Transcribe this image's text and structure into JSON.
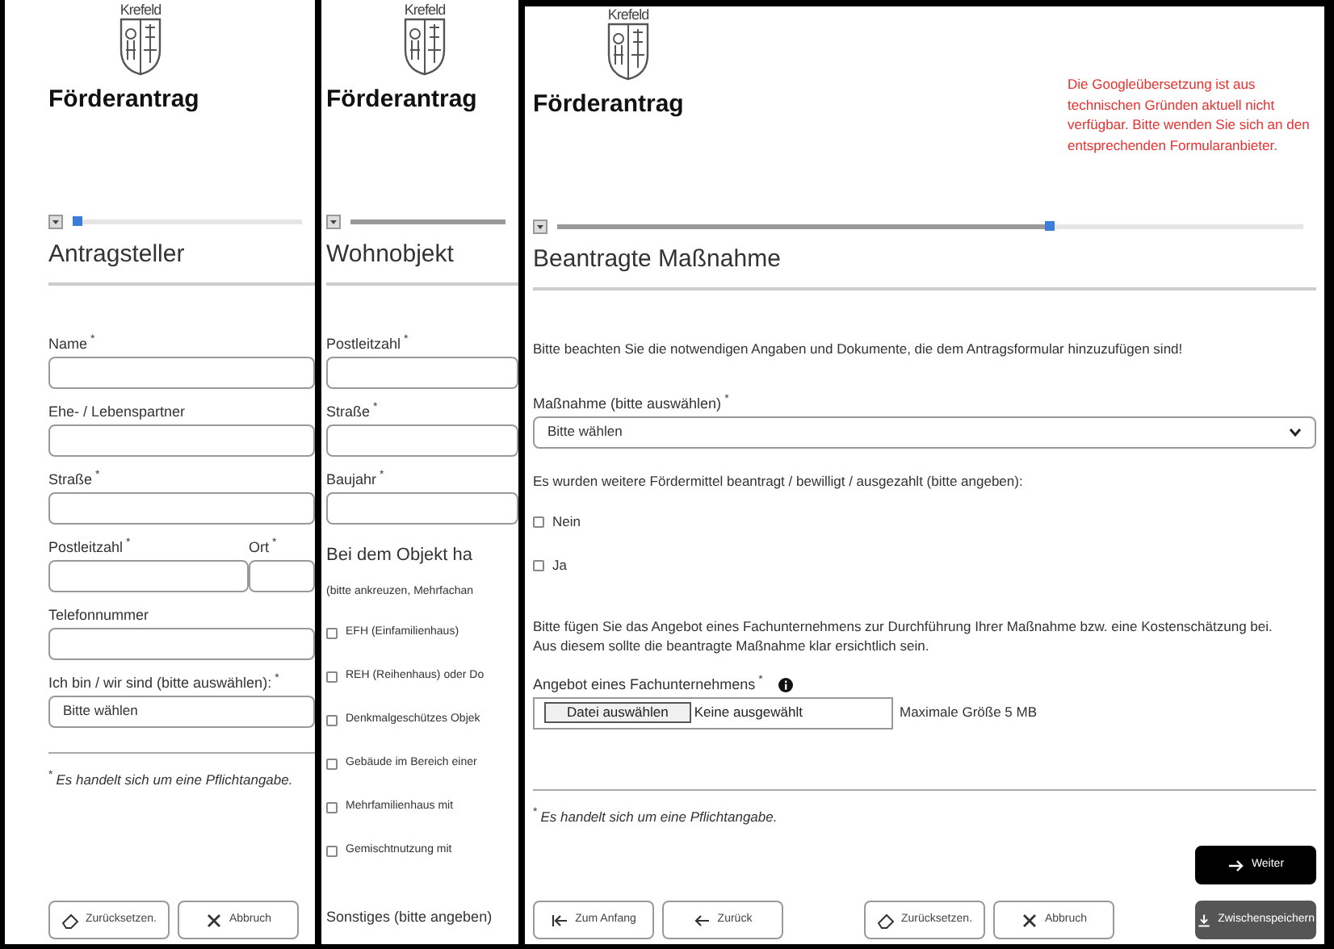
{
  "panels": [
    {
      "logo_text": "Krefeld",
      "title": "Förderantrag",
      "progress": {
        "level": 0.02
      },
      "section_title": "Antragsteller",
      "items": [
        {
          "kind": "field",
          "label": "Name",
          "mark": "*"
        },
        {
          "kind": "field",
          "label": "Ehe- / Lebenspartner"
        },
        {
          "kind": "field",
          "label": "Straße",
          "mark": "*"
        },
        {
          "kind": "pair",
          "fields": [
            {
              "label": "Postleitzahl",
              "mark": "*"
            },
            {
              "label": "Ort",
              "mark": "*"
            }
          ]
        },
        {
          "kind": "field",
          "label": "Telefonnummer"
        },
        {
          "kind": "select",
          "label": "Ich bin / wir sind (bitte auswählen):",
          "mark": "*",
          "value": "Bitte wählen"
        },
        {
          "kind": "divider"
        },
        {
          "kind": "note",
          "mark": "*",
          "text": "Es handelt sich um eine Pflichtangabe."
        }
      ],
      "buttons": [
        [
          {
            "kind": "reset",
            "label": "Zurücksetzen."
          },
          {
            "kind": "cancel",
            "label": "Abbruch"
          }
        ]
      ]
    },
    {
      "logo_text": "Krefeld",
      "title": "Förderantrag",
      "progress": {
        "level": 1
      },
      "section_title": "Wohnobjekt",
      "items": [
        {
          "kind": "field",
          "label": "Postleitzahl",
          "mark": "*"
        },
        {
          "kind": "field",
          "label": "Straße",
          "mark": "*"
        },
        {
          "kind": "field",
          "label": "Baujahr",
          "mark": "*"
        },
        {
          "kind": "heading",
          "text": "Bei dem Objekt ha"
        },
        {
          "kind": "paragraph",
          "lines": [
            "(bitte ankreuzen, Mehrfachan"
          ]
        },
        {
          "kind": "checkbox",
          "label": "EFH (Einfamilienhaus)",
          "checked": false
        },
        {
          "kind": "checkbox",
          "label": "REH (Reihenhaus) oder Do",
          "checked": false
        },
        {
          "kind": "checkbox",
          "label": "Denkmalgeschützes Objek",
          "checked": false
        },
        {
          "kind": "checkbox",
          "label": "Gebäude im Bereich einer",
          "checked": false
        },
        {
          "kind": "checkbox",
          "label": "Mehrfamilienhaus mit",
          "checked": false
        },
        {
          "kind": "checkbox",
          "label": "Gemischtnutzung mit",
          "checked": false
        },
        {
          "kind": "label",
          "text": "Sonstiges (bitte angeben)"
        }
      ]
    },
    {
      "logo_text": "Krefeld",
      "title": "Förderantrag",
      "notice": "Die Googleübersetzung ist aus technischen Gründen aktuell nicht verfügbar. Bitte wenden Sie sich an den entsprechenden Formularanbieter.",
      "progress": {
        "level": 0.66
      },
      "section_title": "Beantragte Maßnahme",
      "items": [
        {
          "kind": "paragraph",
          "lines": [
            "Bitte beachten Sie die notwendigen Angaben und Dokumente, die dem Antragsformular hinzuzufügen sind!"
          ]
        },
        {
          "kind": "select",
          "label": "Maßnahme (bitte auswählen)",
          "mark": "*",
          "value": "Bitte wählen"
        },
        {
          "kind": "paragraph",
          "lines": [
            "Es wurden weitere Fördermittel  beantragt / bewilligt / ausgezahlt (bitte angeben):"
          ]
        },
        {
          "kind": "checkbox",
          "label": "Nein",
          "checked": false
        },
        {
          "kind": "checkbox",
          "label": "Ja",
          "checked": false
        },
        {
          "kind": "paragraph",
          "lines": [
            "Bitte fügen Sie das Angebot eines Fachunternehmens zur Durchführung Ihrer Maßnahme bzw. eine Kostenschätzung bei.",
            "Aus diesem sollte die beantragte Maßnahme klar ersichtlich sein."
          ]
        },
        {
          "kind": "file",
          "label": "Angebot eines Fachunternehmens",
          "mark": "*",
          "button": "Datei auswählen",
          "status": "Keine ausgewählt",
          "hint": "Maximale Größe 5 MB"
        },
        {
          "kind": "divider"
        },
        {
          "kind": "note",
          "mark": "*",
          "text": "Es handelt sich um eine Pflichtangabe."
        }
      ],
      "primary_button": {
        "kind": "next",
        "label": "Weiter"
      },
      "buttons": [
        [
          {
            "kind": "first",
            "label": "Zum Anfang"
          },
          {
            "kind": "back",
            "label": "Zurück"
          }
        ],
        [
          {
            "kind": "reset",
            "label": "Zurücksetzen."
          },
          {
            "kind": "cancel",
            "label": "Abbruch"
          }
        ],
        [
          {
            "kind": "save",
            "label": "Zwischenspeichern"
          }
        ]
      ]
    }
  ]
}
